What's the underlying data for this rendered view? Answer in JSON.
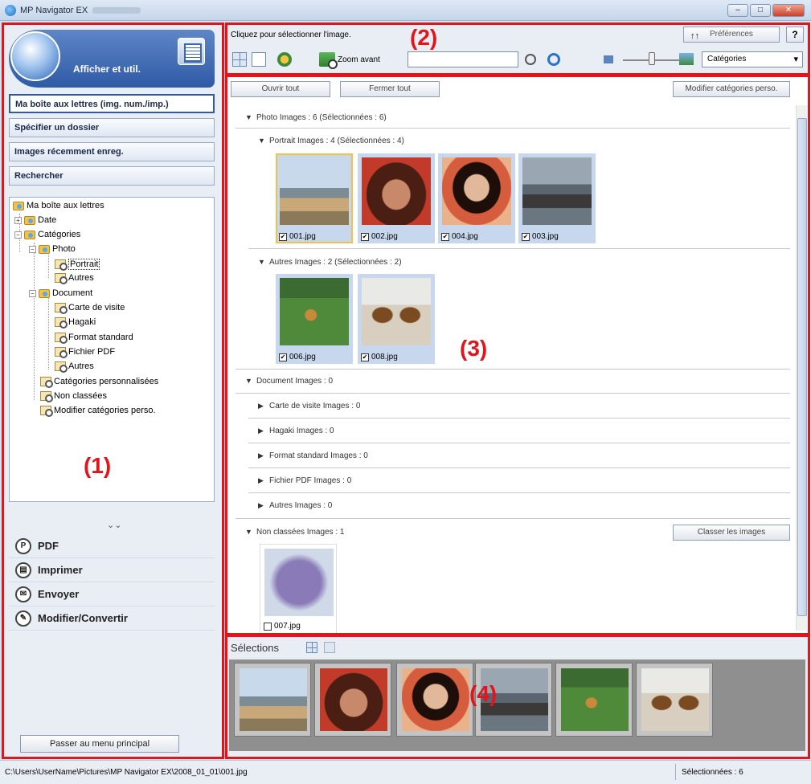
{
  "window": {
    "title": "MP Navigator EX"
  },
  "left": {
    "mode_label": "Afficher et util.",
    "nav": [
      "Ma boîte aux lettres (img. num./imp.)",
      "Spécifier un dossier",
      "Images récemment enreg.",
      "Rechercher"
    ],
    "tree": {
      "root": "Ma boîte aux lettres",
      "date": "Date",
      "categories": "Catégories",
      "photo": "Photo",
      "portrait": "Portrait",
      "photo_autres": "Autres",
      "document": "Document",
      "carte": "Carte de visite",
      "hagaki": "Hagaki",
      "format": "Format standard",
      "pdf": "Fichier PDF",
      "doc_autres": "Autres",
      "cat_perso": "Catégories personnalisées",
      "non_classees": "Non classées",
      "modifier": "Modifier catégories perso."
    },
    "actions": [
      "PDF",
      "Imprimer",
      "Envoyer",
      "Modifier/Convertir"
    ],
    "main_menu": "Passer au menu principal"
  },
  "toolbar": {
    "hint": "Cliquez pour sélectionner l'image.",
    "preferences": "Préférences",
    "help": "?",
    "zoom": "Zoom avant",
    "category_select": "Catégories"
  },
  "content": {
    "open_all": "Ouvrir tout",
    "close_all": "Fermer tout",
    "edit_categories": "Modifier catégories perso.",
    "classify": "Classer les images",
    "photo_hdr": "Photo   Images : 6   (Sélectionnées : 6)",
    "portrait_hdr": "Portrait   Images : 4   (Sélectionnées : 4)",
    "autres_hdr": "Autres   Images : 2   (Sélectionnées : 2)",
    "document_hdr": "Document   Images : 0",
    "carte_hdr": "Carte de visite   Images : 0",
    "hagaki_hdr": "Hagaki   Images : 0",
    "format_hdr": "Format standard   Images : 0",
    "pdf_hdr": "Fichier PDF   Images : 0",
    "docautres_hdr": "Autres   Images : 0",
    "nonclassees_hdr": "Non classées   Images : 1",
    "files": [
      "001.jpg",
      "002.jpg",
      "004.jpg",
      "003.jpg",
      "006.jpg",
      "008.jpg",
      "007.jpg"
    ]
  },
  "selections": {
    "title": "Sélections"
  },
  "status": {
    "path": "C:\\Users\\UserName\\Pictures\\MP Navigator EX\\2008_01_01\\001.jpg",
    "selected": "Sélectionnées : 6"
  },
  "callouts": [
    "(1)",
    "(2)",
    "(3)",
    "(4)"
  ],
  "colors": {
    "callout": "#e3151b",
    "accent": "#2f5aa5",
    "thumb_bg": "#c7d8ee"
  }
}
